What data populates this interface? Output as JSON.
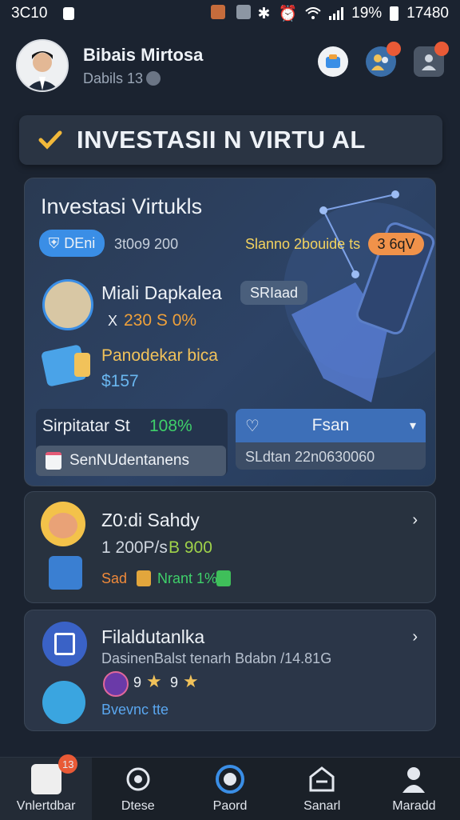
{
  "status_bar": {
    "left_text": "3C10",
    "battery_text": "19%",
    "time": "17480"
  },
  "header": {
    "user_name": "Bibais Mirtosa",
    "user_sub": "Dabils 13"
  },
  "banner": {
    "title": "INVESTASII N  VIRTU AL"
  },
  "main_card": {
    "title": "Investasi Virtukls",
    "tag_label": "DEni",
    "tag_value": "3t0o9 200",
    "right_text": "Slanno 2bouide ts",
    "right_badge": "3 6qV",
    "item1_title": "Miali Dapkalea",
    "item1_tag": "SRIaad",
    "item1_value": "230 S 0%",
    "item1_prefix": "X",
    "item2_title": "Panodekar bica",
    "item2_value": "$157",
    "left_box_label": "Sirpitatar St",
    "left_box_pct": "108%",
    "left_box_sub": "SenNUdentanens",
    "right_box_label": "Fsan",
    "right_box_sub": "SLdtan 22n0630060"
  },
  "card2": {
    "title": "Z0:di Sahdy",
    "values": "1 200P/s",
    "highlight": "B 900",
    "sub_left": "Sad",
    "sub_mid": "Nrant 1%"
  },
  "card3": {
    "title": "Filaldutanlka",
    "desc": "DasinenBalst tenarh Bdabn /14.81G",
    "stars_text": "9",
    "stars_text2": "9",
    "sub_link": "Bvevnc tte"
  },
  "nav": {
    "items": [
      {
        "label": "Vnlertdbar",
        "badge": "13"
      },
      {
        "label": "Dtese"
      },
      {
        "label": "Paord"
      },
      {
        "label": "Sanarl"
      },
      {
        "label": "Maradd"
      }
    ]
  },
  "colors": {
    "accent_blue": "#3a8ee6",
    "accent_orange": "#f0a13a",
    "accent_green": "#3fd06a",
    "check_yellow": "#f1b83a"
  }
}
